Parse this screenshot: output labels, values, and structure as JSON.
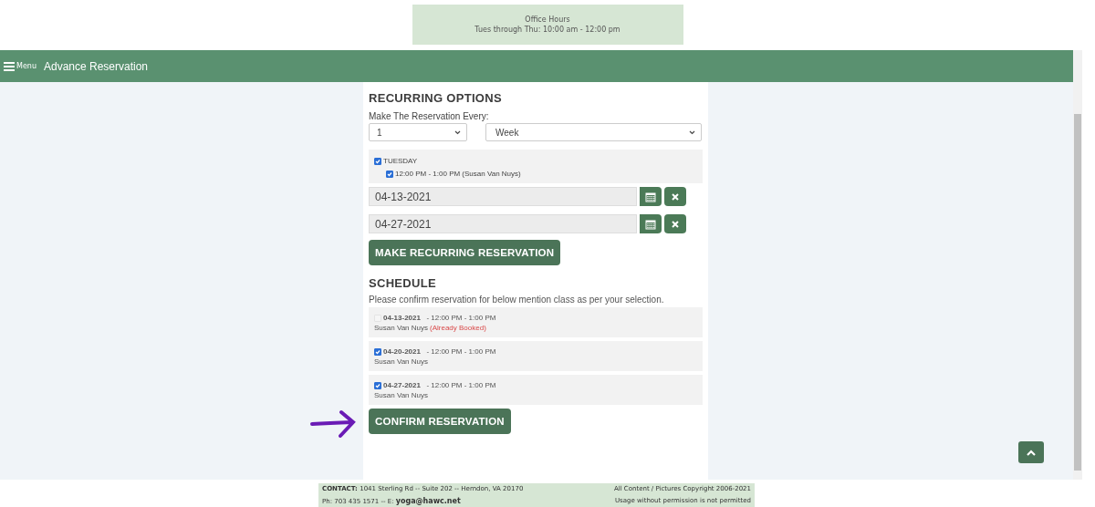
{
  "office_hours": {
    "title": "Office Hours",
    "hours": "Tues through Thu: 10:00 am - 12:00 pm"
  },
  "nav": {
    "menu_label": "Menu",
    "title": "Advance Reservation"
  },
  "recurring": {
    "heading": "RECURRING OPTIONS",
    "every_label": "Make The Reservation Every:",
    "count_select": "1",
    "period_select": "Week",
    "day": {
      "label": "TUESDAY",
      "checked": true,
      "slots": [
        {
          "label": "12:00 PM - 1:00 PM (Susan Van Nuys)",
          "checked": true
        }
      ]
    },
    "dates": [
      "04-13-2021",
      "04-27-2021"
    ],
    "button": "MAKE RECURRING RESERVATION"
  },
  "schedule": {
    "heading": "SCHEDULE",
    "note": "Please confirm reservation for below mention class as per your selection.",
    "items": [
      {
        "date": "04-13-2021",
        "time": "- 12:00 PM - 1:00 PM",
        "instructor": "Susan Van Nuys",
        "status": "(Already Booked)",
        "checked": false,
        "disabled": true
      },
      {
        "date": "04-20-2021",
        "time": "- 12:00 PM - 1:00 PM",
        "instructor": "Susan Van Nuys",
        "checked": true,
        "disabled": false
      },
      {
        "date": "04-27-2021",
        "time": "- 12:00 PM - 1:00 PM",
        "instructor": "Susan Van Nuys",
        "checked": true,
        "disabled": false
      }
    ],
    "button": "CONFIRM RESERVATION"
  },
  "footer": {
    "contact_label": "CONTACT:",
    "address": "1041 Sterling Rd -- Suite 202 -- Herndon, VA 20170",
    "copyright": "All Content / Pictures Copyright 2006-2021",
    "phone": "Ph: 703 435 1571 -- E:",
    "email": "yoga@hawc.net",
    "usage": "Usage without permission is not permitted"
  }
}
